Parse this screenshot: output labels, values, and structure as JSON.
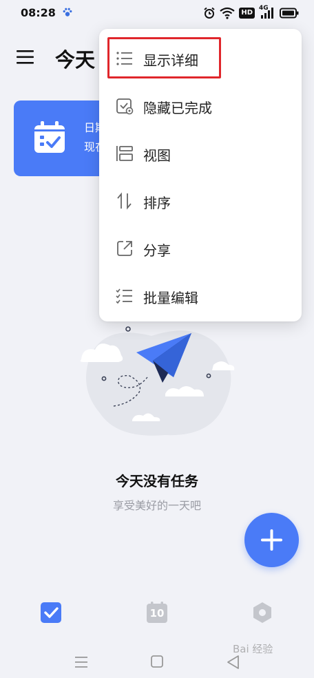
{
  "status_bar": {
    "time": "08:28",
    "network_label": "4G",
    "hd_label": "HD"
  },
  "header": {
    "title": "今天"
  },
  "banner": {
    "line1": "日期",
    "line2": "现在"
  },
  "empty_state": {
    "title": "今天没有任务",
    "subtitle": "享受美好的一天吧"
  },
  "popup_menu": {
    "items": [
      {
        "label": "显示详细",
        "icon": "details-list-icon",
        "highlighted": true
      },
      {
        "label": "隐藏已完成",
        "icon": "hide-completed-icon"
      },
      {
        "label": "视图",
        "icon": "view-icon"
      },
      {
        "label": "排序",
        "icon": "sort-icon"
      },
      {
        "label": "分享",
        "icon": "share-icon"
      },
      {
        "label": "批量编辑",
        "icon": "batch-edit-icon"
      }
    ]
  },
  "bottom_tabs": {
    "calendar_day": "10",
    "items": [
      {
        "name": "tasks",
        "icon": "check-square-icon",
        "active": true
      },
      {
        "name": "calendar",
        "icon": "calendar-icon",
        "active": false
      },
      {
        "name": "settings",
        "icon": "hexagon-settings-icon",
        "active": false
      }
    ]
  },
  "watermark": {
    "text": "Bai 经验"
  },
  "colors": {
    "accent": "#4a7bf7",
    "background": "#f1f2f7",
    "highlight_border": "#e0262b",
    "inactive_icon": "#c4c6cc"
  }
}
